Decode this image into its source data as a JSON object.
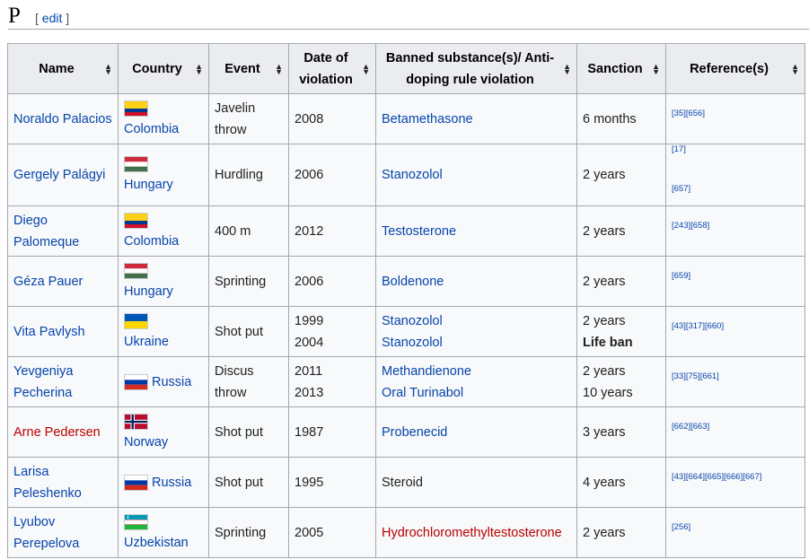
{
  "section": {
    "letter": "P",
    "edit_open": "[",
    "edit_label": "edit",
    "edit_close": "]"
  },
  "table": {
    "headers": [
      "Name",
      "Country",
      "Event",
      "Date of violation",
      "Banned substance(s)/ Anti-doping rule violation",
      "Sanction",
      "Reference(s)"
    ],
    "rows": [
      {
        "name": "Noraldo Palacios",
        "name_red": false,
        "country": "Colombia",
        "flag": "colombia-flag-icon",
        "event": "Javelin throw",
        "dates": [
          "2008"
        ],
        "substances": [
          {
            "text": "Betamethasone",
            "red": false
          }
        ],
        "sanctions": [
          {
            "text": "6 months",
            "bold": false
          }
        ],
        "refs": [
          "[35][656]"
        ]
      },
      {
        "name": "Gergely Palágyi",
        "name_red": false,
        "country": "Hungary",
        "flag": "hungary-flag-icon",
        "event": "Hurdling",
        "dates": [
          "2006"
        ],
        "substances": [
          {
            "text": "Stanozolol",
            "red": false
          }
        ],
        "sanctions": [
          {
            "text": "2 years",
            "bold": false
          }
        ],
        "refs": [
          "[17]",
          "[657]"
        ]
      },
      {
        "name": "Diego Palomeque",
        "name_red": false,
        "country": "Colombia",
        "flag": "colombia-flag-icon",
        "event": "400 m",
        "dates": [
          "2012"
        ],
        "substances": [
          {
            "text": "Testosterone",
            "red": false
          }
        ],
        "sanctions": [
          {
            "text": "2 years",
            "bold": false
          }
        ],
        "refs": [
          "[243][658]"
        ]
      },
      {
        "name": "Géza Pauer",
        "name_red": false,
        "country": "Hungary",
        "flag": "hungary-flag-icon",
        "event": "Sprinting",
        "dates": [
          "2006"
        ],
        "substances": [
          {
            "text": "Boldenone",
            "red": false
          }
        ],
        "sanctions": [
          {
            "text": "2 years",
            "bold": false
          }
        ],
        "refs": [
          "[659]"
        ]
      },
      {
        "name": "Vita Pavlysh",
        "name_red": false,
        "country": "Ukraine",
        "flag": "ukraine-flag-icon",
        "event": "Shot put",
        "dates": [
          "1999",
          "2004"
        ],
        "substances": [
          {
            "text": "Stanozolol",
            "red": false
          },
          {
            "text": "Stanozolol",
            "red": false
          }
        ],
        "sanctions": [
          {
            "text": "2 years",
            "bold": false
          },
          {
            "text": "Life ban",
            "bold": true
          }
        ],
        "refs": [
          "[43][317][660]"
        ]
      },
      {
        "name": "Yevgeniya Pecherina",
        "name_red": false,
        "country": "Russia",
        "flag": "russia-flag-icon",
        "event": "Discus throw",
        "dates": [
          "2011",
          "2013"
        ],
        "substances": [
          {
            "text": "Methandienone",
            "red": false
          },
          {
            "text": "Oral Turinabol",
            "red": false
          }
        ],
        "sanctions": [
          {
            "text": "2 years",
            "bold": false
          },
          {
            "text": "10 years",
            "bold": false
          }
        ],
        "refs": [
          "[33][75][661]"
        ]
      },
      {
        "name": "Arne Pedersen",
        "name_red": true,
        "country": "Norway",
        "flag": "norway-flag-icon",
        "event": "Shot put",
        "dates": [
          "1987"
        ],
        "substances": [
          {
            "text": "Probenecid",
            "red": false
          }
        ],
        "sanctions": [
          {
            "text": "3 years",
            "bold": false
          }
        ],
        "refs": [
          "[662][663]"
        ]
      },
      {
        "name": "Larisa Peleshenko",
        "name_red": false,
        "country": "Russia",
        "flag": "russia-flag-icon",
        "event": "Shot put",
        "dates": [
          "1995"
        ],
        "substances": [
          {
            "text": "Steroid",
            "red": false,
            "plain": true
          }
        ],
        "sanctions": [
          {
            "text": "4 years",
            "bold": false
          }
        ],
        "refs": [
          "[43][664][665][666][667]"
        ]
      },
      {
        "name": "Lyubov Perepelova",
        "name_red": false,
        "country": "Uzbekistan",
        "flag": "uzbekistan-flag-icon",
        "event": "Sprinting",
        "dates": [
          "2005"
        ],
        "substances": [
          {
            "text": "Hydrochloromethyltestosterone",
            "red": true
          }
        ],
        "sanctions": [
          {
            "text": "2 years",
            "bold": false
          }
        ],
        "refs": [
          "[256]"
        ]
      }
    ]
  },
  "colors": {
    "link": "#0645ad",
    "redlink": "#ba0000",
    "header_bg": "#eaecf0",
    "cell_bg": "#f8f9fa",
    "border": "#a2a9b1"
  }
}
